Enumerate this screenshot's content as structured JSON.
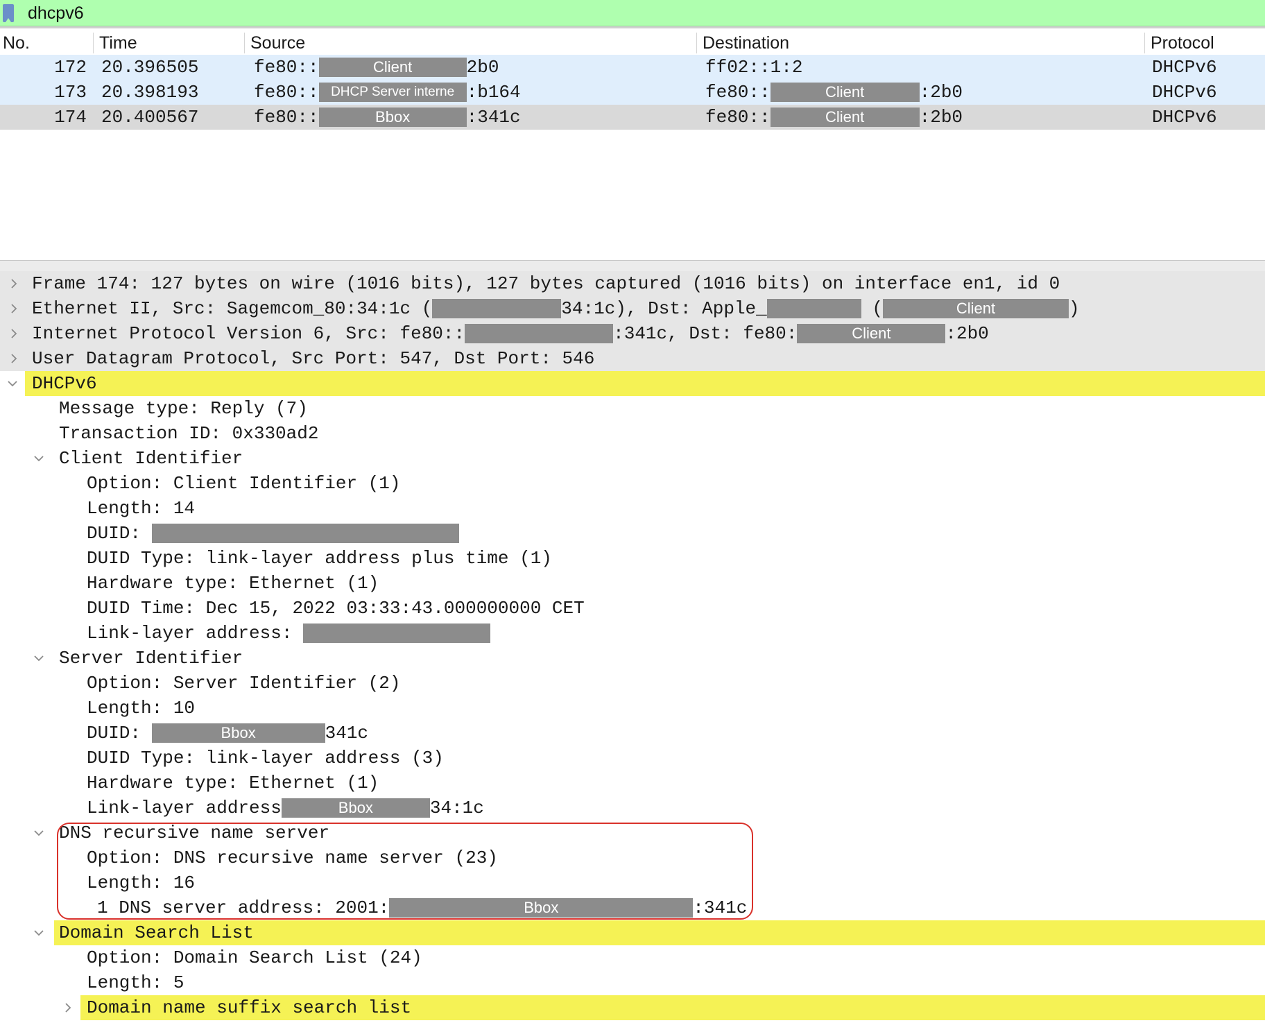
{
  "filter": {
    "value": "dhcpv6"
  },
  "columns": {
    "no": "No.",
    "time": "Time",
    "source": "Source",
    "destination": "Destination",
    "protocol": "Protocol"
  },
  "packets": [
    {
      "no": "172",
      "time": "20.396505",
      "src_prefix": "fe80::",
      "src_label": "Client",
      "src_suffix": "2b0",
      "dst_prefix": "ff02::1:2",
      "dst_label": "",
      "dst_suffix": "",
      "protocol": "DHCPv6"
    },
    {
      "no": "173",
      "time": "20.398193",
      "src_prefix": "fe80::",
      "src_label": "DHCP Server interne",
      "src_suffix": ":b164",
      "dst_prefix": "fe80::",
      "dst_label": "Client",
      "dst_suffix": ":2b0",
      "protocol": "DHCPv6"
    },
    {
      "no": "174",
      "time": "20.400567",
      "src_prefix": "fe80::",
      "src_label": "Bbox",
      "src_suffix": ":341c",
      "dst_prefix": "fe80::",
      "dst_label": "Client",
      "dst_suffix": ":2b0",
      "protocol": "DHCPv6"
    }
  ],
  "details": {
    "frame": "Frame 174: 127 bytes on wire (1016 bits), 127 bytes captured (1016 bits) on interface en1, id 0",
    "ethernet": {
      "a": "Ethernet II, Src: Sagemcom_80:34:1c (",
      "b": "34:1c), Dst: Apple_",
      "c": " (",
      "label": "Client",
      "d": ")"
    },
    "ipv6": {
      "a": "Internet Protocol Version 6, Src: fe80::",
      "b": ":341c, Dst: fe80:",
      "label": "Client",
      "c": ":2b0"
    },
    "udp": "User Datagram Protocol, Src Port: 547, Dst Port: 546",
    "dhcpv6": "DHCPv6",
    "message_type": "Message type: Reply (7)",
    "transaction_id": "Transaction ID: 0x330ad2",
    "client_identifier": {
      "title": "Client Identifier",
      "option": "Option: Client Identifier (1)",
      "length": "Length: 14",
      "duid": "DUID: ",
      "duid_type": "DUID Type: link-layer address plus time (1)",
      "hw_type": "Hardware type: Ethernet (1)",
      "duid_time": "DUID Time: Dec 15, 2022 03:33:43.000000000 CET",
      "link_layer": "Link-layer address: "
    },
    "server_identifier": {
      "title": "Server Identifier",
      "option": "Option: Server Identifier (2)",
      "length": "Length: 10",
      "duid": "DUID: ",
      "duid_label": "Bbox",
      "duid_suffix": "341c",
      "duid_type": "DUID Type: link-layer address (3)",
      "hw_type": "Hardware type: Ethernet (1)",
      "link_layer": "Link-layer address",
      "link_label": "Bbox",
      "link_suffix": "34:1c"
    },
    "dns": {
      "title": "DNS recursive name server",
      "option": "Option: DNS recursive name server (23)",
      "length": "Length: 16",
      "address_prefix": "1 DNS server address: 2001:",
      "address_label": "Bbox",
      "address_suffix": ":341c"
    },
    "domain_search": {
      "title": "Domain Search List",
      "option": "Option: Domain Search List (24)",
      "length": "Length: 5",
      "suffix_list": "Domain name suffix search list"
    }
  },
  "colors": {
    "filter_bg": "#afffaf",
    "row_selected": "#d9d9d9",
    "row_normal": "#e0eefc",
    "highlight": "#f5f255",
    "redaction": "#8c8c8c",
    "callout": "#d9322b"
  }
}
